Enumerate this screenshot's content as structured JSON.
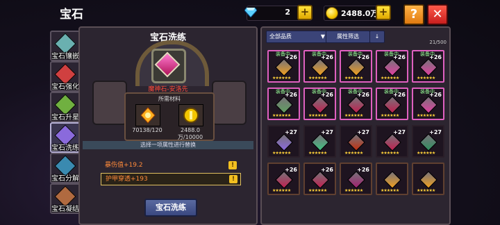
{
  "header": {
    "title": "宝石",
    "gems": "2",
    "gold": "2488.0万"
  },
  "side_tabs": [
    {
      "label": "宝石镶嵌",
      "color": "#6ab0b0"
    },
    {
      "label": "宝石强化",
      "color": "#d04040"
    },
    {
      "label": "宝石升星",
      "color": "#70b040"
    },
    {
      "label": "宝石洗练",
      "color": "#8a6adc"
    },
    {
      "label": "宝石分解",
      "color": "#3a8ab0"
    },
    {
      "label": "宝石凝结",
      "color": "#b06a40"
    }
  ],
  "refine": {
    "title": "宝石洗练",
    "gem_name": "魔神石-安洛先",
    "materials_title": "所需材料",
    "material_1_count": "70138/120",
    "material_2_count": "2488.0万/10000",
    "choose_hint": "选择一项属性进行替换",
    "attrs": [
      "暴伤值+19.2",
      "护甲穿透+193"
    ],
    "button": "宝石洗练"
  },
  "inventory": {
    "filter_all": "全部品质",
    "filter_attr": "属性筛选",
    "slots": "21/500",
    "cells": [
      {
        "lvl": "+26",
        "tag": "装备中",
        "color": "#f0a020",
        "equipped": true
      },
      {
        "lvl": "+26",
        "tag": "装备中",
        "color": "#f0a020",
        "equipped": true
      },
      {
        "lvl": "+26",
        "tag": "装备中",
        "color": "#f0a020",
        "equipped": true
      },
      {
        "lvl": "+26",
        "tag": "装备中",
        "color": "#e040a0",
        "equipped": true
      },
      {
        "lvl": "+26",
        "tag": "装备中",
        "color": "#e040a0",
        "equipped": true
      },
      {
        "lvl": "+26",
        "tag": "装备中",
        "color": "#60a060",
        "equipped": true
      },
      {
        "lvl": "+26",
        "tag": "装备中",
        "color": "#c02050",
        "equipped": true
      },
      {
        "lvl": "+26",
        "tag": "装备中",
        "color": "#c02050",
        "equipped": true
      },
      {
        "lvl": "+26",
        "tag": "装备中",
        "color": "#c02050",
        "equipped": true
      },
      {
        "lvl": "+26",
        "tag": "装备中",
        "color": "#e040a0",
        "equipped": true
      },
      {
        "lvl": "+27",
        "tag": "",
        "color": "#8a6adc",
        "equipped": false
      },
      {
        "lvl": "+27",
        "tag": "",
        "color": "#40c080",
        "equipped": false
      },
      {
        "lvl": "+27",
        "tag": "",
        "color": "#c03010",
        "equipped": false
      },
      {
        "lvl": "+27",
        "tag": "",
        "color": "#c02050",
        "equipped": false
      },
      {
        "lvl": "+27",
        "tag": "",
        "color": "#309060",
        "equipped": false
      },
      {
        "lvl": "+26",
        "tag": "",
        "color": "#c02050",
        "equipped": false
      },
      {
        "lvl": "+26",
        "tag": "",
        "color": "#c02050",
        "equipped": false
      },
      {
        "lvl": "+26",
        "tag": "",
        "color": "#a02070",
        "equipped": false
      },
      {
        "lvl": "",
        "tag": "",
        "color": "#f0a020",
        "equipped": false
      },
      {
        "lvl": "",
        "tag": "",
        "color": "#f0a020",
        "equipped": false
      }
    ]
  }
}
